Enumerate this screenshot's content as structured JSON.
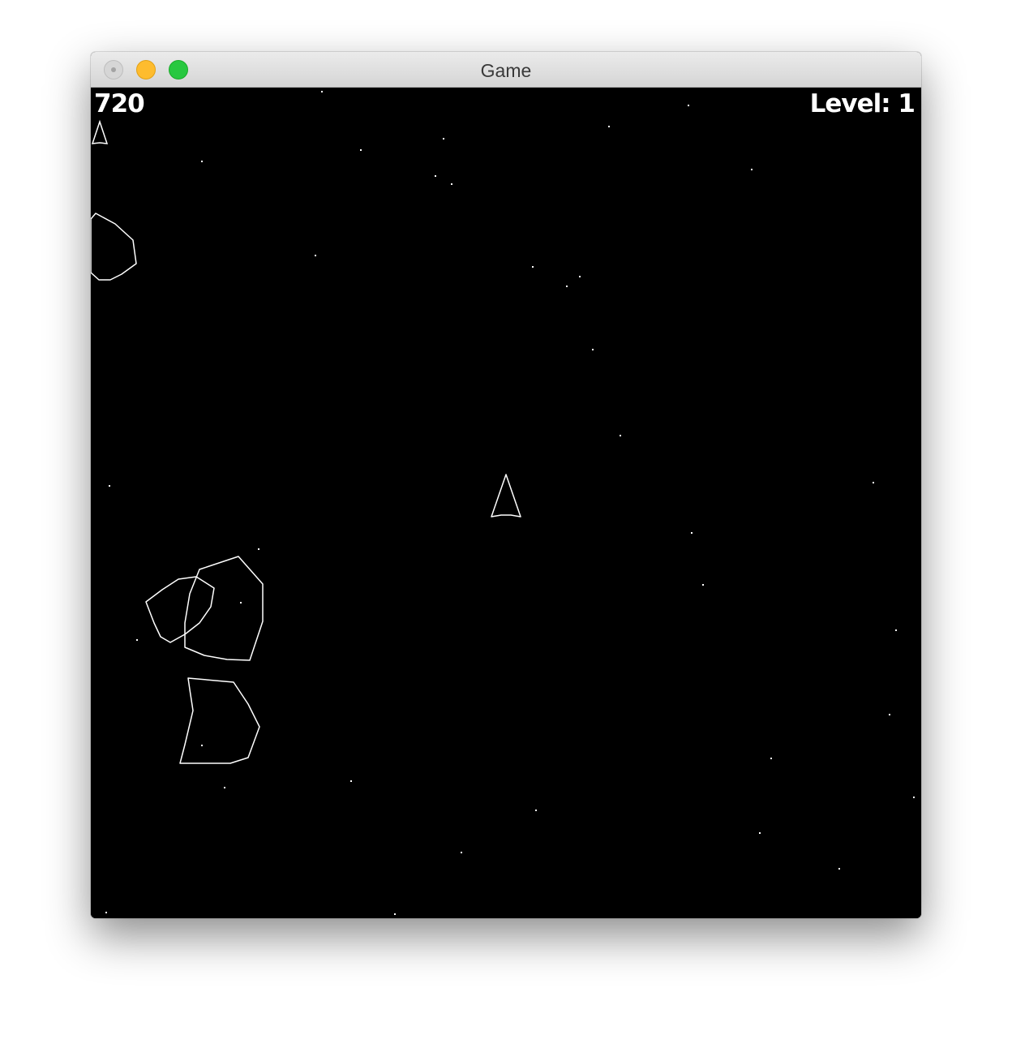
{
  "window": {
    "title": "Game",
    "controls": [
      "close-icon",
      "minimize-icon",
      "zoom-icon"
    ]
  },
  "hud": {
    "score": "720",
    "level": "Level: 1",
    "lives": 1
  },
  "colors": {
    "background": "#000000",
    "foreground": "#ffffff"
  },
  "scene": {
    "ship": {
      "heading": "up"
    },
    "asteroid_count": 4,
    "style": "vector-outline"
  }
}
